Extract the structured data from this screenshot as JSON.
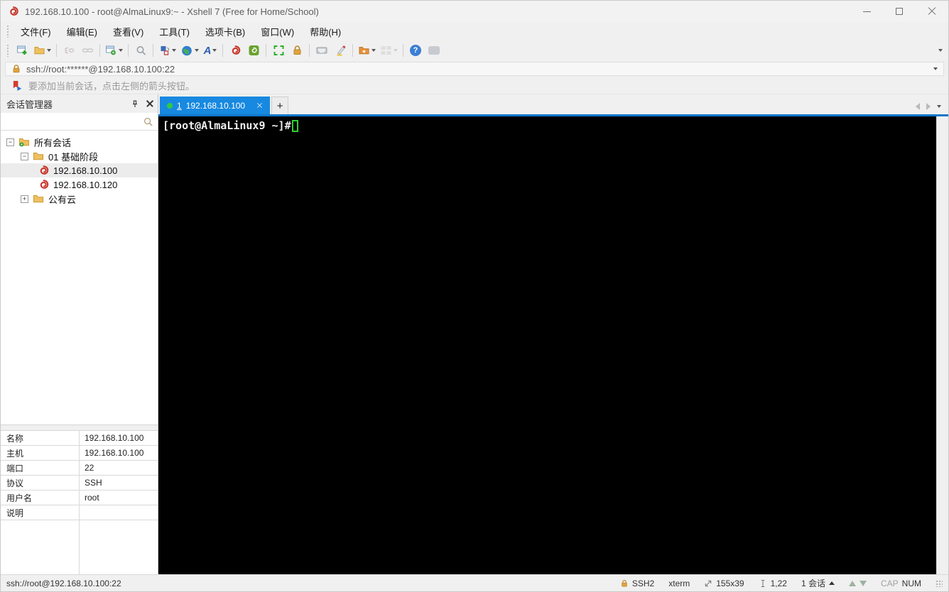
{
  "window": {
    "title": "192.168.10.100 - root@AlmaLinux9:~ - Xshell 7 (Free for Home/School)"
  },
  "menu": {
    "items": [
      "文件(F)",
      "编辑(E)",
      "查看(V)",
      "工具(T)",
      "选项卡(B)",
      "窗口(W)",
      "帮助(H)"
    ]
  },
  "toolbar": {
    "icons": [
      "new-session",
      "open-folder",
      "disconnect",
      "reconnect",
      "session-properties",
      "find",
      "compose-pane",
      "encoding-globe",
      "font",
      "xshell-logo",
      "xftp",
      "fullscreen",
      "lock",
      "virtual-keyboard",
      "highlight-pen",
      "transfer-folder-plus",
      "tile-layout",
      "help",
      "feedback-balloon"
    ]
  },
  "address_bar": {
    "value": "ssh://root:******@192.168.10.100:22"
  },
  "info_bar": {
    "text": "要添加当前会话，点击左侧的箭头按钮。"
  },
  "sidebar": {
    "title": "会话管理器",
    "tree": [
      {
        "label": "所有会话"
      },
      {
        "label": "01 基础阶段"
      },
      {
        "label": "192.168.10.100"
      },
      {
        "label": "192.168.10.120"
      },
      {
        "label": "公有云"
      }
    ],
    "properties": [
      {
        "label": "名称",
        "value": "192.168.10.100"
      },
      {
        "label": "主机",
        "value": "192.168.10.100"
      },
      {
        "label": "端口",
        "value": "22"
      },
      {
        "label": "协议",
        "value": "SSH"
      },
      {
        "label": "用户名",
        "value": "root"
      },
      {
        "label": "说明",
        "value": ""
      }
    ]
  },
  "tabs": {
    "active": {
      "index_label": "1",
      "label": "192.168.10.100"
    }
  },
  "terminal": {
    "prompt": "[root@AlmaLinux9 ~]#"
  },
  "status_bar": {
    "left": "ssh://root@192.168.10.100:22",
    "protocol": "SSH2",
    "term_type": "xterm",
    "size": "155x39",
    "cursor_pos": "1,22",
    "session_count": "1 会话",
    "cap": "CAP",
    "num": "NUM"
  },
  "colors": {
    "tab_active": "#1789e0",
    "tab_underline": "#1177ca",
    "connected_dot": "#2ecc40",
    "terminal_bg": "#000000",
    "terminal_fg": "#efefef",
    "cursor_green": "#2fd12f",
    "xshell_red": "#c8372c",
    "folder_yellow": "#f0c060",
    "lock_gold": "#e2a33d"
  }
}
